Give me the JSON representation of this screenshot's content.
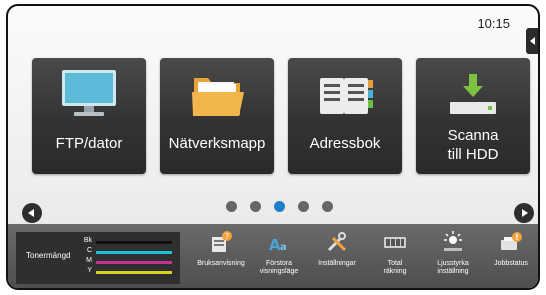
{
  "status": {
    "time": "10:15"
  },
  "tiles": [
    {
      "name": "ftp-pc",
      "label_line1": "FTP/dator",
      "label_line2": "",
      "icon": "monitor-icon"
    },
    {
      "name": "network-folder",
      "label_line1": "Nätverksmapp",
      "label_line2": "",
      "icon": "folder-icon"
    },
    {
      "name": "address-book",
      "label_line1": "Adressbok",
      "label_line2": "",
      "icon": "address-book-icon"
    },
    {
      "name": "scan-to-hdd",
      "label_line1": "Scanna",
      "label_line2": "till HDD",
      "icon": "hdd-download-icon"
    }
  ],
  "pager": {
    "pages": 5,
    "active_index": 2
  },
  "toner": {
    "label": "Tonermängd",
    "rows": [
      {
        "key": "Bk",
        "color": "#111111",
        "level": 1.0
      },
      {
        "key": "C",
        "color": "#19c3d6",
        "level": 1.0
      },
      {
        "key": "M",
        "color": "#c2338f",
        "level": 1.0
      },
      {
        "key": "Y",
        "color": "#d7d31a",
        "level": 1.0
      }
    ]
  },
  "tools": [
    {
      "label_line1": "Bruksanvisning",
      "label_line2": "",
      "icon": "manual-icon"
    },
    {
      "label_line1": "Förstora",
      "label_line2": "visningsläge",
      "icon": "enlarge-display-icon"
    },
    {
      "label_line1": "Inställningar",
      "label_line2": "",
      "icon": "settings-tools-icon"
    },
    {
      "label_line1": "Total",
      "label_line2": "räkning",
      "icon": "counter-icon"
    },
    {
      "label_line1": "Ljusstyrka",
      "label_line2": "inställning",
      "icon": "brightness-icon"
    },
    {
      "label_line1": "Jobbstatus",
      "label_line2": "",
      "icon": "job-status-icon"
    }
  ],
  "colors": {
    "accent": "#1e7fc8",
    "tile_bg": "#333333",
    "bottom_bar": "#555555"
  }
}
